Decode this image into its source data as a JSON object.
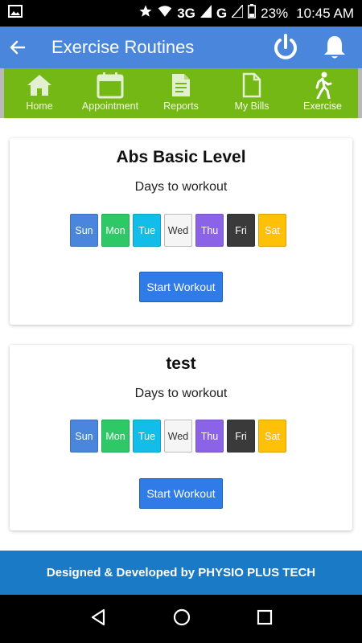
{
  "status_bar": {
    "network": "3G",
    "network2": "G",
    "battery": "23%",
    "time": "10:45 AM"
  },
  "app_bar": {
    "title": "Exercise Routines"
  },
  "tabs": [
    {
      "label": "Home",
      "icon": "home-icon"
    },
    {
      "label": "Appointment",
      "icon": "calendar-icon"
    },
    {
      "label": "Reports",
      "icon": "report-icon"
    },
    {
      "label": "My Bills",
      "icon": "bill-icon"
    },
    {
      "label": "Exercise",
      "icon": "walking-icon",
      "active": true
    }
  ],
  "routines": [
    {
      "name": "Abs Basic Level",
      "days_label": "Days to workout",
      "days": [
        "Sun",
        "Mon",
        "Tue",
        "Wed",
        "Thu",
        "Fri",
        "Sat"
      ],
      "start_label": "Start Workout"
    },
    {
      "name": "test",
      "days_label": "Days to workout",
      "days": [
        "Sun",
        "Mon",
        "Tue",
        "Wed",
        "Thu",
        "Fri",
        "Sat"
      ],
      "start_label": "Start Workout"
    }
  ],
  "day_colors": {
    "Sun": "#4a86dc",
    "Mon": "#2ec866",
    "Tue": "#13bde9",
    "Wed": "#f5f5f5",
    "Thu": "#8b63e6",
    "Fri": "#3a3a3a",
    "Sat": "#fec107"
  },
  "footer": {
    "text": "Designed & Developed by PHYSIO PLUS TECH"
  },
  "colors": {
    "app_bar": "#4a86dc",
    "tab_bar": "#74b816",
    "footer": "#1a7ac6",
    "button": "#2f7be7"
  }
}
